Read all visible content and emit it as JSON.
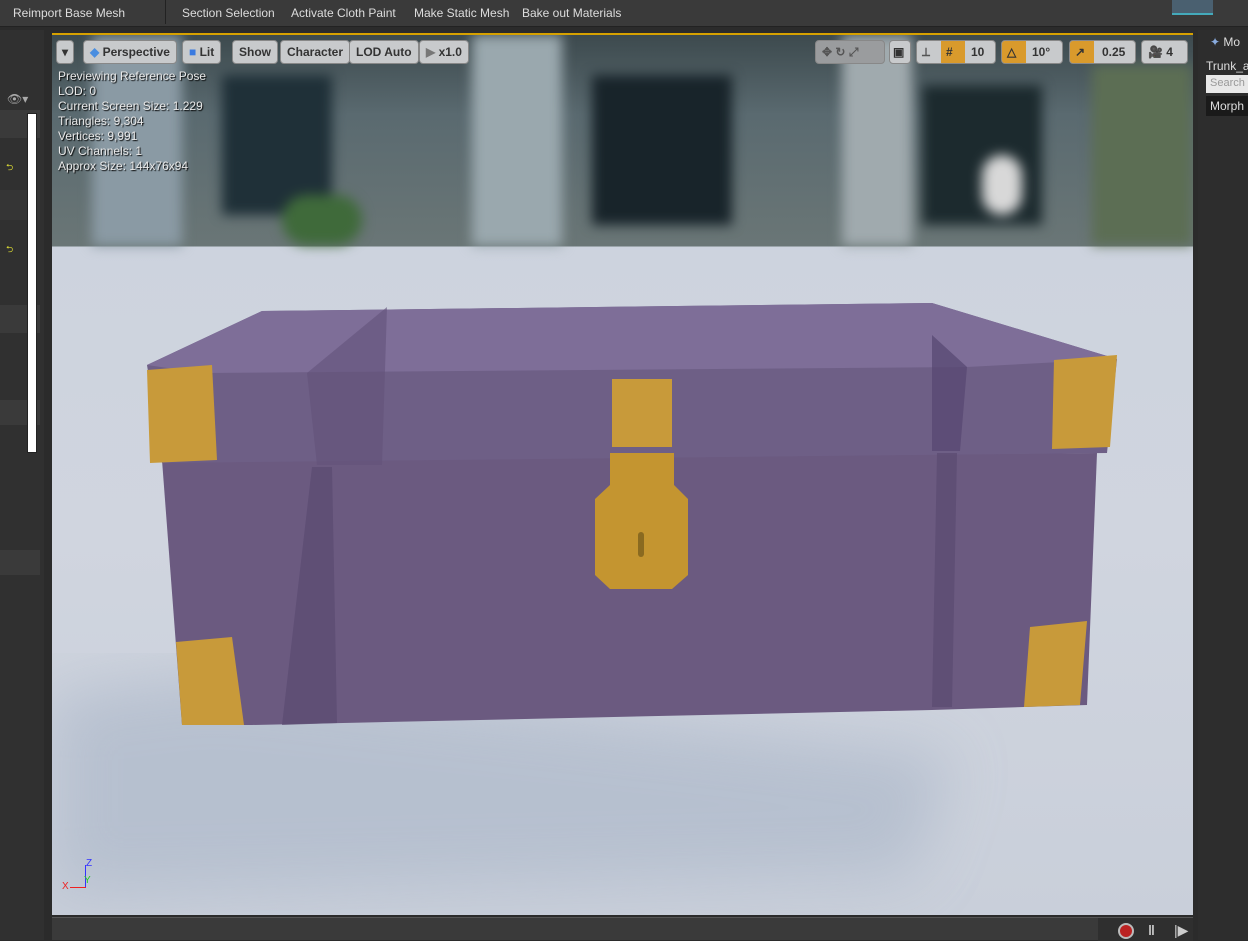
{
  "toolbar": {
    "items": [
      "Reimport Base Mesh",
      "Section Selection",
      "Activate Cloth Paint",
      "Make Static Mesh",
      "Bake out Materials"
    ]
  },
  "viewport": {
    "buttons": {
      "menu": "▾",
      "perspective": "Perspective",
      "lit": "Lit",
      "show": "Show",
      "character": "Character",
      "lod": "LOD Auto",
      "speed": "x1.0"
    },
    "right_controls": {
      "grid_snap": "10",
      "rotation_snap": "10°",
      "scale_snap": "0.25",
      "camera_speed": "4"
    },
    "stats": [
      "Previewing Reference Pose",
      "LOD: 0",
      "Current Screen Size: 1.229",
      "Triangles: 9,304",
      "Vertices: 9,991",
      "UV Channels: 1",
      "Approx Size: 144x76x94"
    ],
    "axis": {
      "x": "X",
      "y": "Y",
      "z": "Z"
    },
    "colors": {
      "active": "#d99a2c",
      "trunk": "#6b5a80",
      "metal": "#c89a3a"
    }
  },
  "right_panel": {
    "tab": "Mo",
    "asset": "Trunk_a",
    "search_placeholder": "Search",
    "morph": "Morph"
  }
}
